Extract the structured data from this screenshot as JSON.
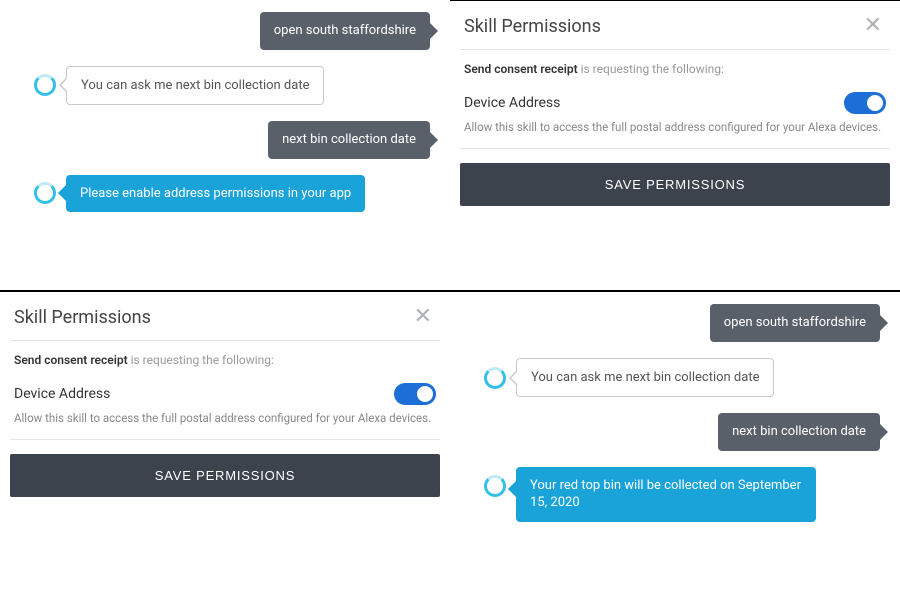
{
  "chat1": {
    "user1": "open south staffordshire",
    "alexa1": "You can ask me next bin collection date",
    "user2": "next bin collection date",
    "alexa2": "Please enable address permissions in your app"
  },
  "perm": {
    "title": "Skill Permissions",
    "requester": "Send consent receipt",
    "requesting_suffix": " is requesting the following:",
    "item_name": "Device Address",
    "item_desc": "Allow this skill to access the full postal address configured for your Alexa devices.",
    "save_label": "SAVE PERMISSIONS"
  },
  "chat2": {
    "user1": "open south staffordshire",
    "alexa1": "You can ask me next bin collection date",
    "user2": "next bin collection date",
    "alexa2": "Your red top bin will be collected on September 15, 2020"
  }
}
